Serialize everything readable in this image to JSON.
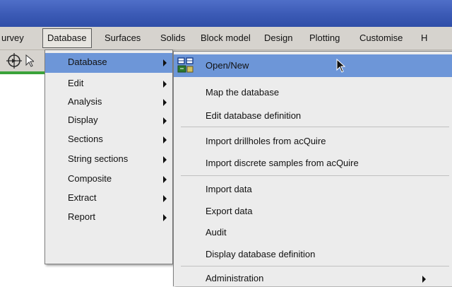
{
  "menubar": {
    "items": [
      {
        "label": "urvey"
      },
      {
        "label": "Database"
      },
      {
        "label": "Surfaces"
      },
      {
        "label": "Solids"
      },
      {
        "label": "Block model"
      },
      {
        "label": "Design"
      },
      {
        "label": "Plotting"
      },
      {
        "label": "Customise"
      },
      {
        "label": "H"
      }
    ]
  },
  "database_menu": {
    "items": [
      {
        "label": "Database"
      },
      {
        "label": "Edit"
      },
      {
        "label": "Analysis"
      },
      {
        "label": "Display"
      },
      {
        "label": "Sections"
      },
      {
        "label": "String sections"
      },
      {
        "label": "Composite"
      },
      {
        "label": "Extract"
      },
      {
        "label": "Report"
      }
    ]
  },
  "submenu": {
    "items": [
      {
        "label": "Open/New"
      },
      {
        "label": "Map the database"
      },
      {
        "label": "Edit database definition"
      },
      {
        "label": "Import drillholes from acQuire"
      },
      {
        "label": "Import discrete samples from acQuire"
      },
      {
        "label": "Import data"
      },
      {
        "label": "Export data"
      },
      {
        "label": "Audit"
      },
      {
        "label": "Display database definition"
      },
      {
        "label": "Administration"
      }
    ]
  },
  "colors": {
    "titlebar": "#3b5ab5",
    "menu_highlight": "#6d96d8",
    "menubar_bg": "#d6d3ce",
    "accent_line": "#3aa23a"
  }
}
